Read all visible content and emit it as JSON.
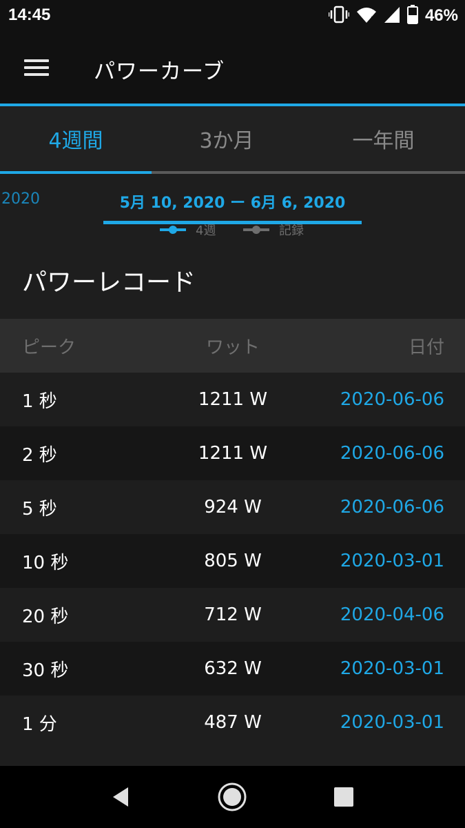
{
  "status_bar": {
    "time": "14:45",
    "battery_percent": "46%",
    "icons": [
      "vibrate-icon",
      "wifi-icon",
      "cellular-signal-icon",
      "battery-icon"
    ]
  },
  "app_bar": {
    "menu_icon": "hamburger-menu-icon",
    "title": "パワーカーブ"
  },
  "tabs": [
    {
      "label": "4週間",
      "active": true
    },
    {
      "label": "3か月",
      "active": false
    },
    {
      "label": "一年間",
      "active": false
    }
  ],
  "date_range": {
    "previous": "2020",
    "current": "5月 10, 2020 ー 6月 6, 2020"
  },
  "legend": [
    {
      "label": "4週",
      "color": "#1fa8e6"
    },
    {
      "label": "記録",
      "color": "#6e6e6e"
    }
  ],
  "power_records": {
    "title": "パワーレコード",
    "columns": {
      "peak": "ピーク",
      "watts": "ワット",
      "date": "日付"
    },
    "rows": [
      {
        "peak": "1 秒",
        "watts": "1211 W",
        "date": "2020-06-06"
      },
      {
        "peak": "2 秒",
        "watts": "1211 W",
        "date": "2020-06-06"
      },
      {
        "peak": "5 秒",
        "watts": "924 W",
        "date": "2020-06-06"
      },
      {
        "peak": "10 秒",
        "watts": "805 W",
        "date": "2020-03-01"
      },
      {
        "peak": "20 秒",
        "watts": "712 W",
        "date": "2020-04-06"
      },
      {
        "peak": "30 秒",
        "watts": "632 W",
        "date": "2020-03-01"
      },
      {
        "peak": "1 分",
        "watts": "487 W",
        "date": "2020-03-01"
      }
    ]
  },
  "nav_bar": {
    "buttons": [
      "back-icon",
      "home-icon",
      "recents-icon"
    ]
  },
  "colors": {
    "accent": "#1fa8e6",
    "background": "#1e1e1e",
    "bar_background": "#111111"
  }
}
